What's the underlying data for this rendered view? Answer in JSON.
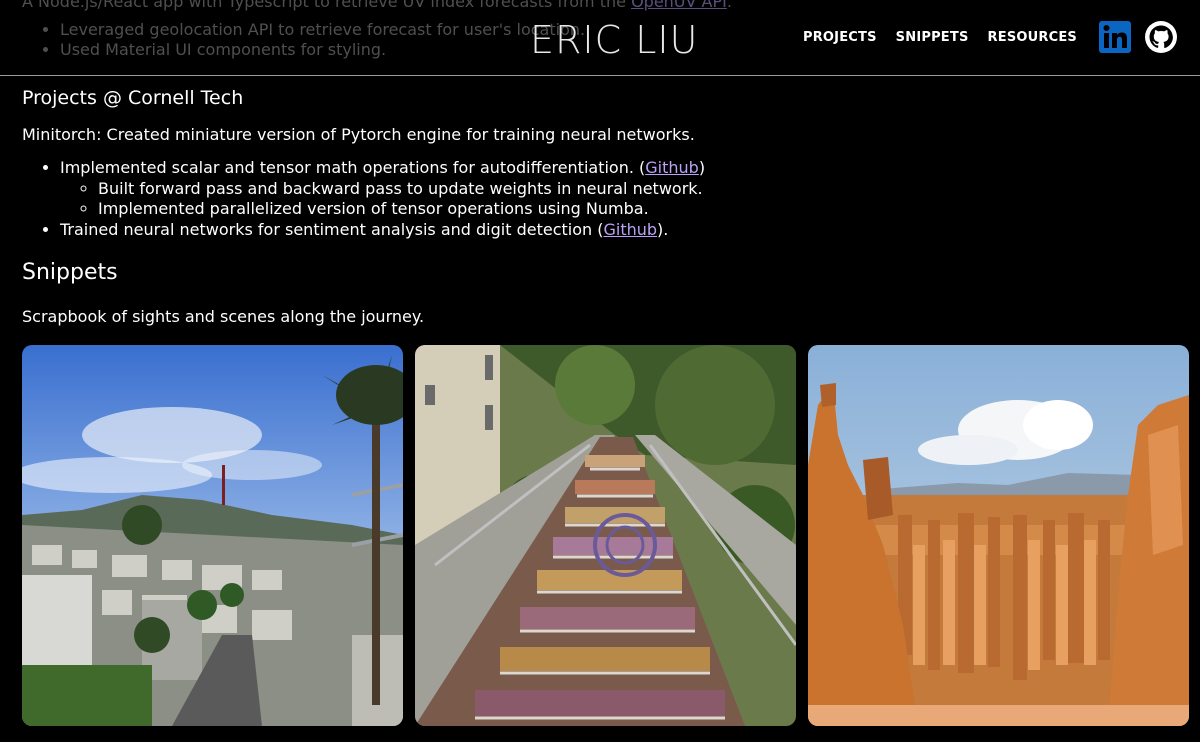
{
  "behind": {
    "line_text": "A Node.js/React app with Typescript to retrieve UV index forecasts from the ",
    "line_link": "OpenUV API",
    "line_end": ".",
    "bullets": [
      "Leveraged geolocation API to retrieve forecast for user's location.",
      "Used Material UI components for styling."
    ]
  },
  "header": {
    "logo": "ERIC LIU",
    "nav": [
      "PROJECTS",
      "SNIPPETS",
      "RESOURCES"
    ],
    "icons": [
      "linkedin-icon",
      "github-icon"
    ]
  },
  "projects": {
    "heading": "Projects @ Cornell Tech",
    "intro": "Minitorch: Created miniature version of Pytorch engine for training neural networks.",
    "bullet1_text": "Implemented scalar and tensor math operations for autodifferentiation. (",
    "bullet1_link": "Github",
    "bullet1_end": ")",
    "sub_bullets": [
      "Built forward pass and backward pass to update weights in neural network.",
      "Implemented parallelized version of tensor operations using Numba."
    ],
    "bullet2_text": "Trained neural networks for sentiment analysis and digit detection (",
    "bullet2_link": "Github",
    "bullet2_end": ")."
  },
  "snippets": {
    "heading": "Snippets",
    "description": "Scrapbook of sights and scenes along the journey."
  },
  "colors": {
    "background": "#000000",
    "link": "#b9a3f5",
    "linkedin": "#0a66c2"
  }
}
